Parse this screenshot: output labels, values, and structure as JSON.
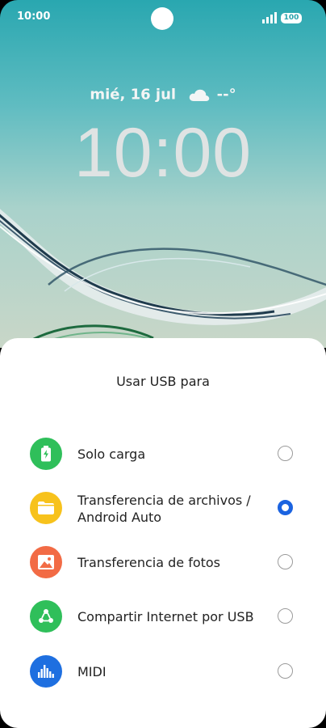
{
  "status_bar": {
    "time": "10:00",
    "battery": "100",
    "signal_icon": "signal-icon"
  },
  "lock_screen": {
    "date": "mié, 16 jul",
    "weather_icon": "cloud-icon",
    "temperature": "--°",
    "clock": "10:00"
  },
  "usb_sheet": {
    "title": "Usar USB para",
    "selected_index": 1,
    "options": [
      {
        "label": "Solo carga",
        "icon": "battery-charging-icon",
        "color": "#2fbf5a",
        "selected": false
      },
      {
        "label": "Transferencia de archivos / Android Auto",
        "icon": "folder-icon",
        "color": "#f7c21c",
        "selected": true
      },
      {
        "label": "Transferencia de fotos",
        "icon": "image-icon",
        "color": "#f26b45",
        "selected": false
      },
      {
        "label": "Compartir Internet por USB",
        "icon": "share-icon",
        "color": "#2fbf5a",
        "selected": false
      },
      {
        "label": "MIDI",
        "icon": "equalizer-icon",
        "color": "#1e6fe0",
        "selected": false
      }
    ]
  },
  "colors": {
    "accent": "#1b63e0",
    "wallpaper_top": "#29a7b0"
  }
}
